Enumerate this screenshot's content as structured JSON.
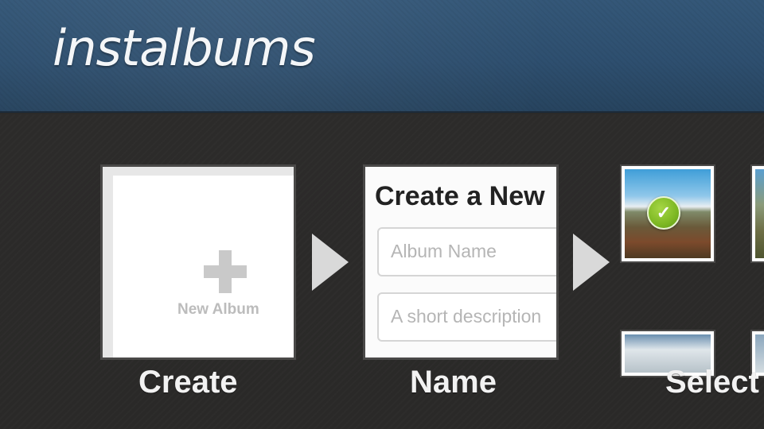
{
  "header": {
    "logo_text": "instalbums"
  },
  "steps": [
    {
      "label": "Create",
      "card": {
        "new_album_label": "New Album",
        "icon": "plus-icon"
      }
    },
    {
      "label": "Name",
      "card": {
        "title": "Create a New",
        "album_name_placeholder": "Album Name",
        "description_placeholder": "A short description"
      }
    },
    {
      "label": "Select",
      "card": {
        "selected_icon": "checkmark-icon"
      }
    }
  ],
  "arrows": [
    "arrow-right-icon",
    "arrow-right-icon"
  ],
  "colors": {
    "header_blue": "#2e4f6f",
    "background": "#2b2a29",
    "check_green": "#7db823"
  }
}
